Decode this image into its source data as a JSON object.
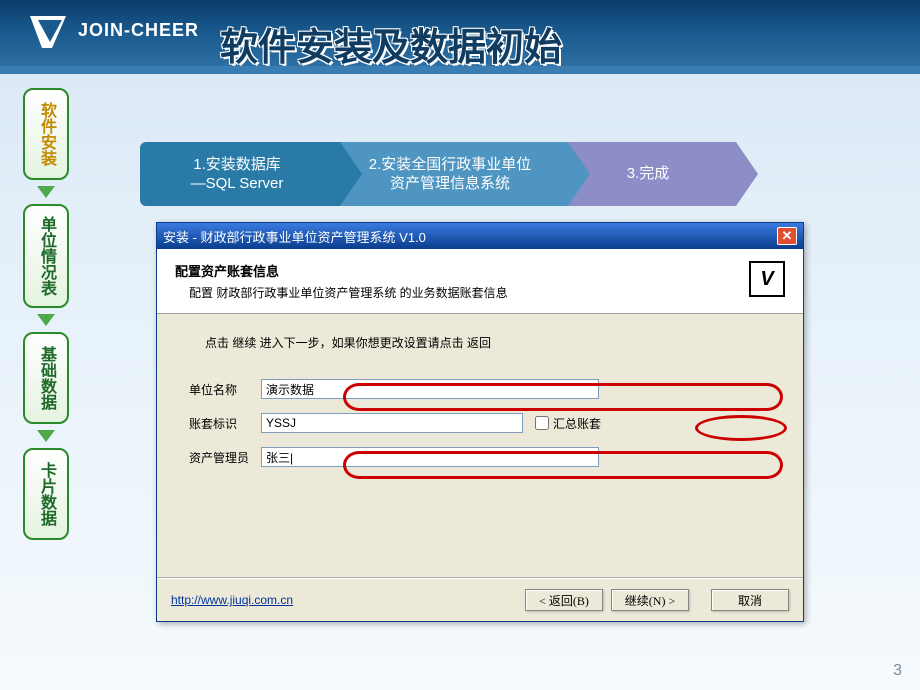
{
  "header": {
    "brand": "JOIN-CHEER",
    "title": "软件安装及数据初始"
  },
  "sidebar": {
    "items": [
      {
        "label": "软件安装",
        "active": true
      },
      {
        "label": "单位情况表"
      },
      {
        "label": "基础数据"
      },
      {
        "label": "卡片数据"
      }
    ]
  },
  "steps": {
    "s1_line1": "1.安装数据库",
    "s1_line2": "—SQL Server",
    "s2_line1": "2.安装全国行政事业单位",
    "s2_line2": "资产管理信息系统",
    "s3": "3.完成"
  },
  "installer": {
    "title": "安装 - 财政部行政事业单位资产管理系统 V1.0",
    "section_title": "配置资产账套信息",
    "section_sub": "配置 财政部行政事业单位资产管理系统 的业务数据账套信息",
    "hint": "点击 继续 进入下一步，如果你想更改设置请点击 返回",
    "icon_letter": "V",
    "fields": {
      "org_label": "单位名称",
      "org_value": "演示数据",
      "code_label": "账套标识",
      "code_value": "YSSJ",
      "sum_label": "汇总账套",
      "admin_label": "资产管理员",
      "admin_value": "张三|"
    },
    "link": "http://www.jiuqi.com.cn",
    "buttons": {
      "back": "< 返回(B)",
      "next": "继续(N) >",
      "cancel": "取消"
    }
  },
  "page_number": "3"
}
